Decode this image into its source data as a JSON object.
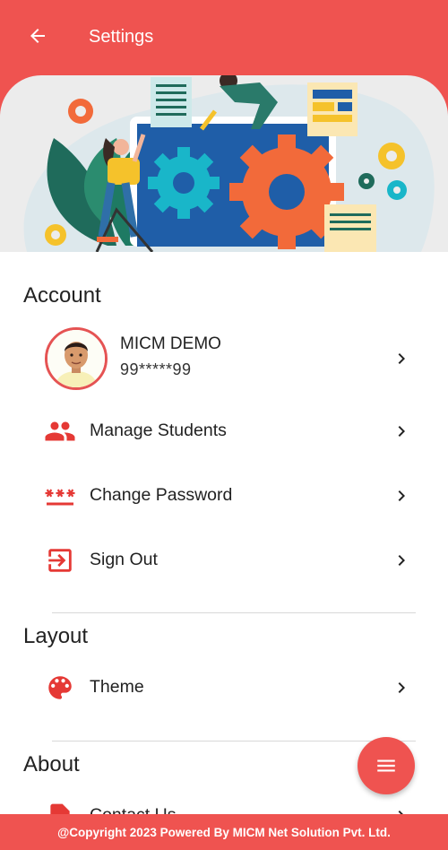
{
  "header": {
    "title": "Settings"
  },
  "sections": {
    "account": "Account",
    "layout": "Layout",
    "about": "About"
  },
  "profile": {
    "name": "MICM DEMO",
    "phone": "99*****99"
  },
  "account_items": {
    "manage_students": "Manage Students",
    "change_password": "Change Password",
    "sign_out": "Sign Out"
  },
  "layout_items": {
    "theme": "Theme"
  },
  "about_items": {
    "contact_us": "Contact Us"
  },
  "footer": {
    "copyright": "@Copyright 2023 Powered By MICM Net Solution Pvt. Ltd."
  },
  "colors": {
    "primary": "#ef5350",
    "icon": "#e53935"
  }
}
